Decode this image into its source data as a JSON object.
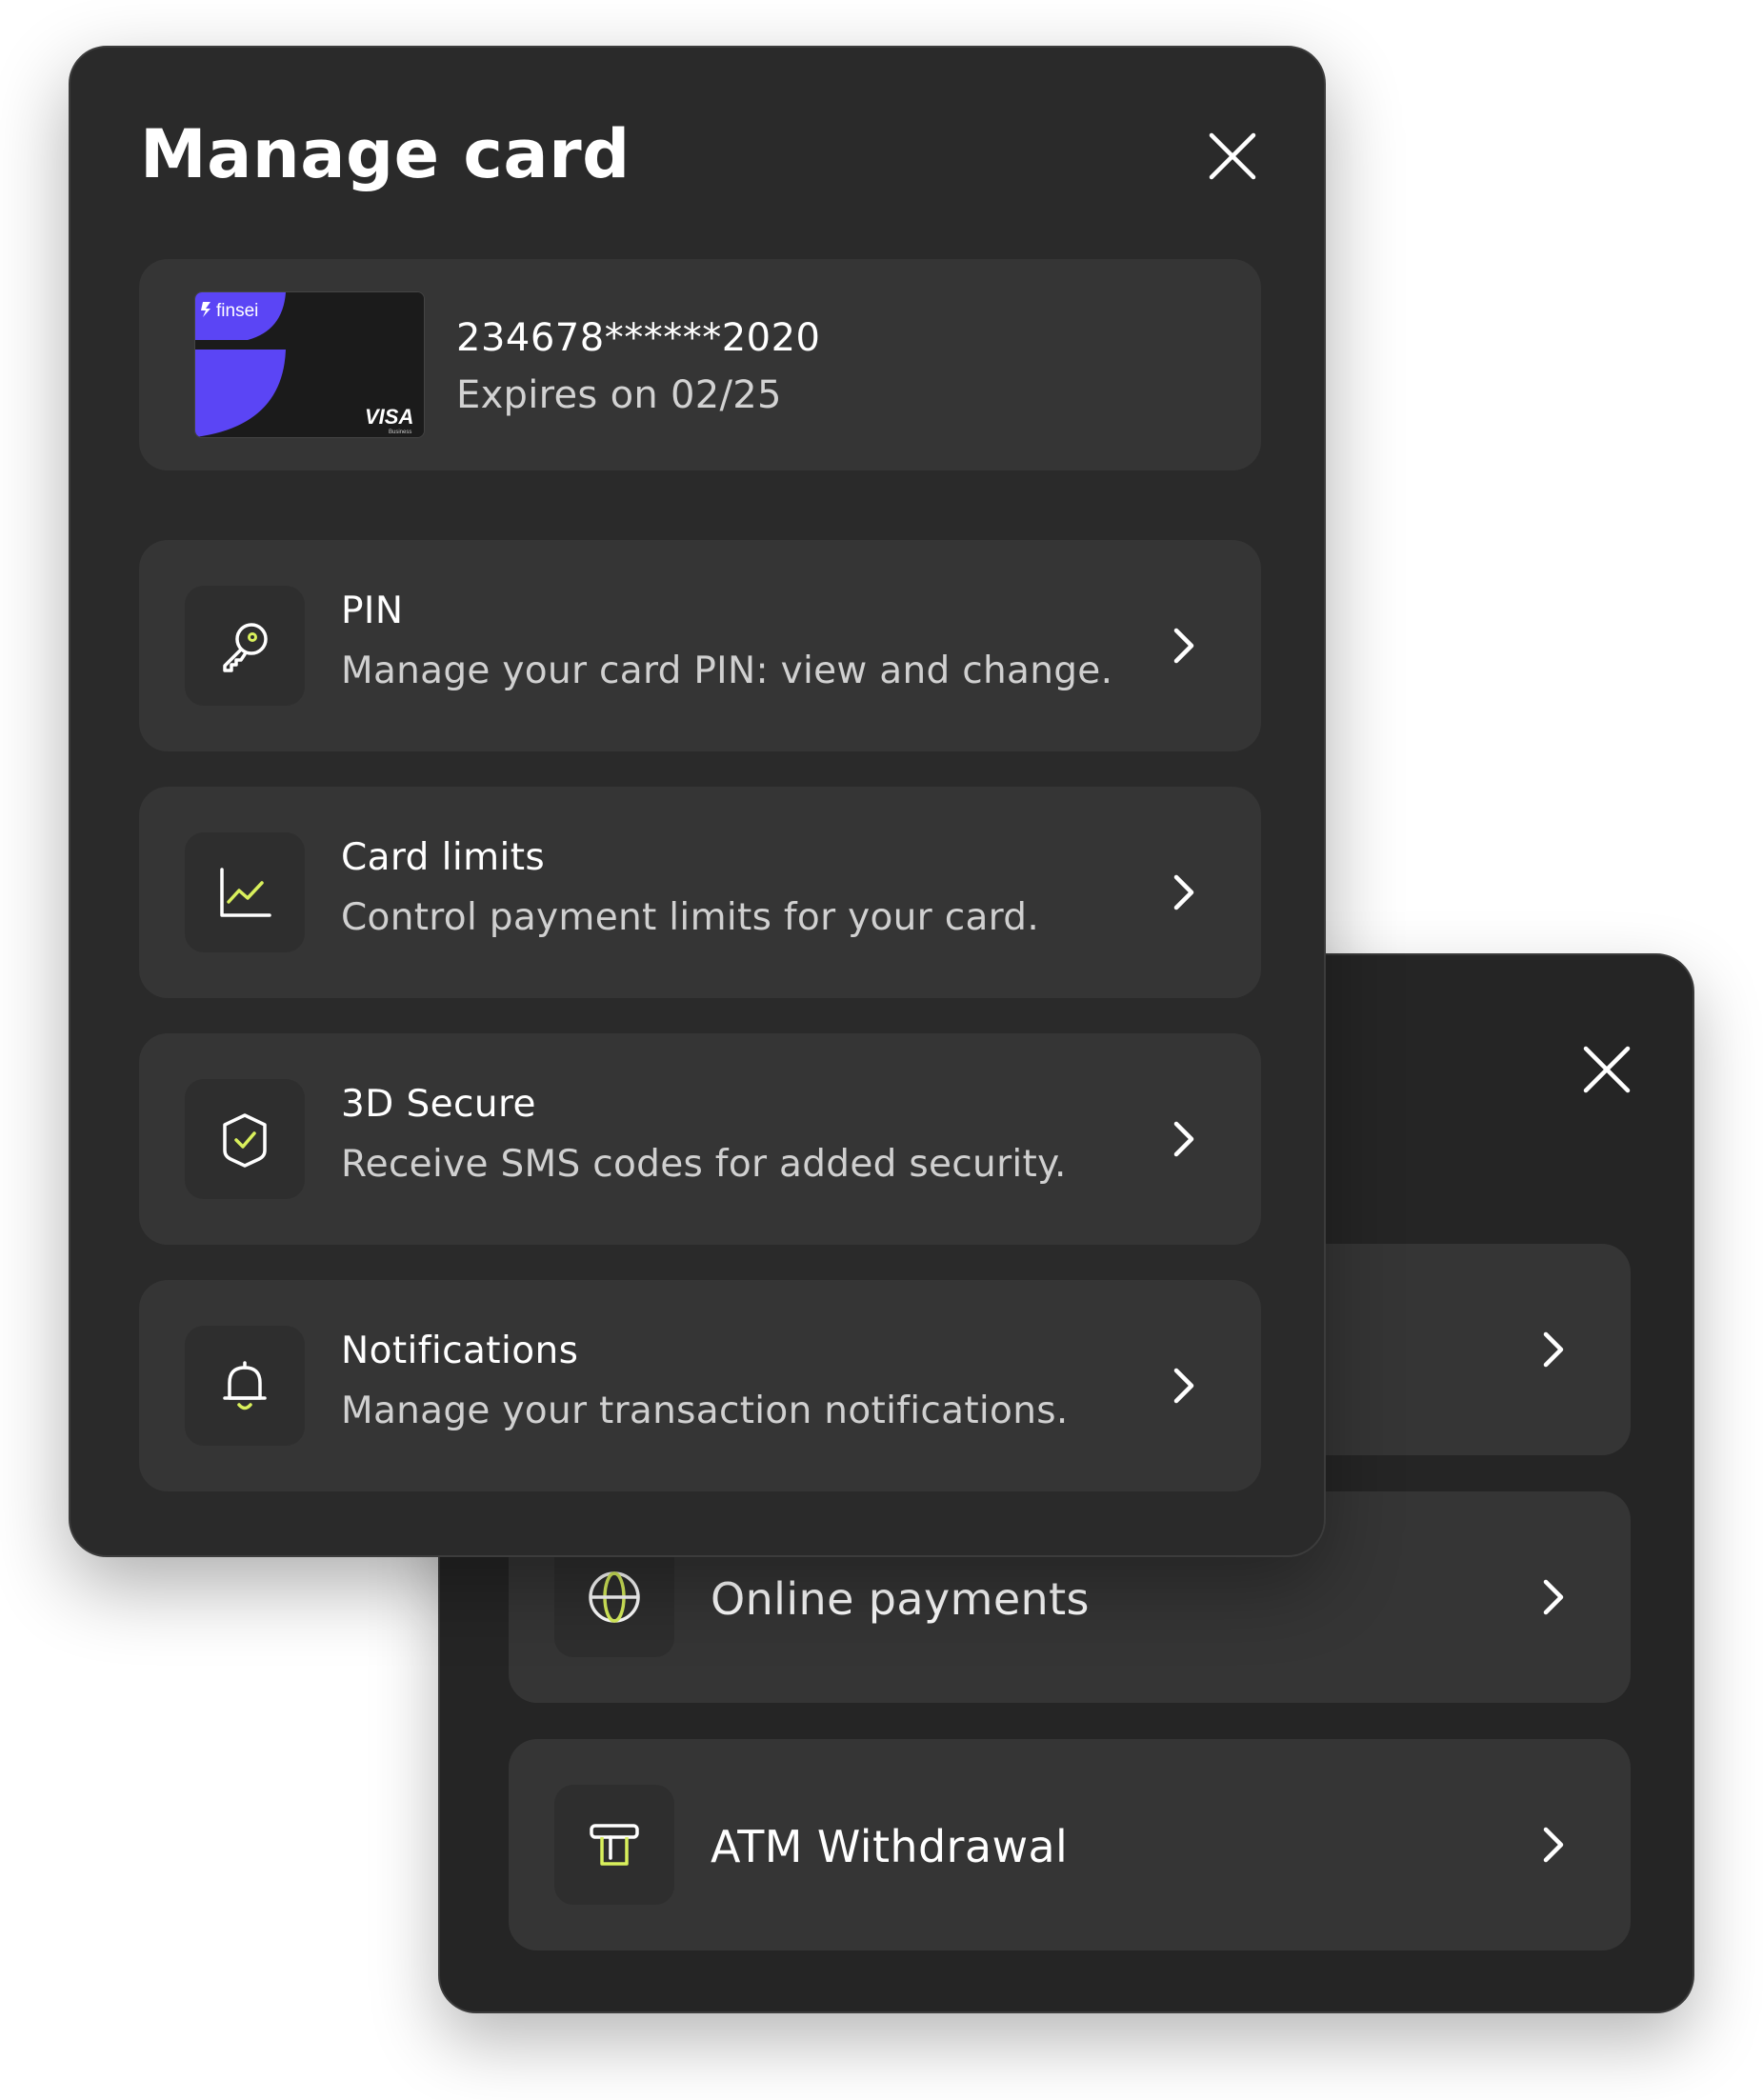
{
  "colors": {
    "accent": "#d9f05c",
    "card_purple": "#5b45f5",
    "panel_bg": "#2a2a2a",
    "row_bg": "#353535"
  },
  "back_panel": {
    "close_icon": "close-icon",
    "items": [
      {
        "label": "",
        "icon": "hidden-item"
      },
      {
        "label": "Online payments",
        "icon": "globe-icon"
      },
      {
        "label": "ATM Withdrawal",
        "icon": "atm-icon"
      }
    ]
  },
  "front_panel": {
    "title": "Manage card",
    "close_icon": "close-icon",
    "card": {
      "brand": "finsei",
      "network": "VISA",
      "network_sub": "Business",
      "number": "234678******2020",
      "expiry": "Expires on 02/25"
    },
    "items": [
      {
        "title": "PIN",
        "description": "Manage your card PIN: view and change.",
        "icon": "key-icon"
      },
      {
        "title": "Card limits",
        "description": "Control payment limits for your card.",
        "icon": "chart-icon"
      },
      {
        "title": "3D Secure",
        "description": "Receive SMS codes for added security.",
        "icon": "shield-check-icon"
      },
      {
        "title": "Notifications",
        "description": "Manage your transaction notifications.",
        "icon": "bell-icon"
      }
    ]
  }
}
